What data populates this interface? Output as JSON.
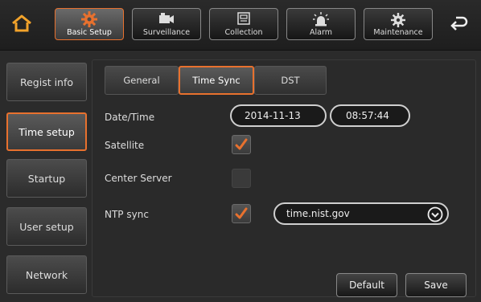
{
  "top_tabs": [
    {
      "label": "Basic Setup",
      "icon": "gear-icon",
      "active": true
    },
    {
      "label": "Surveillance",
      "icon": "camera-icon",
      "active": false
    },
    {
      "label": "Collection",
      "icon": "storage-icon",
      "active": false
    },
    {
      "label": "Alarm",
      "icon": "alarm-icon",
      "active": false
    },
    {
      "label": "Maintenance",
      "icon": "maintenance-icon",
      "active": false
    }
  ],
  "nav": {
    "items": [
      {
        "label": "Regist info"
      },
      {
        "label": "Time setup"
      },
      {
        "label": "Startup"
      },
      {
        "label": "User setup"
      },
      {
        "label": "Network"
      }
    ],
    "active_index": 1
  },
  "sub_tabs": [
    {
      "label": "General"
    },
    {
      "label": "Time Sync"
    },
    {
      "label": "DST"
    }
  ],
  "fields": {
    "datetime_label": "Date/Time",
    "date_value": "2014-11-13",
    "time_value": "08:57:44",
    "satellite_label": "Satellite",
    "satellite_checked": true,
    "center_server_label": "Center Server",
    "center_server_checked": false,
    "ntp_label": "NTP sync",
    "ntp_checked": true,
    "ntp_server": "time.nist.gov"
  },
  "buttons": {
    "default_label": "Default",
    "save_label": "Save"
  },
  "colors": {
    "accent": "#e8712e",
    "home_icon": "#f2a32b"
  }
}
